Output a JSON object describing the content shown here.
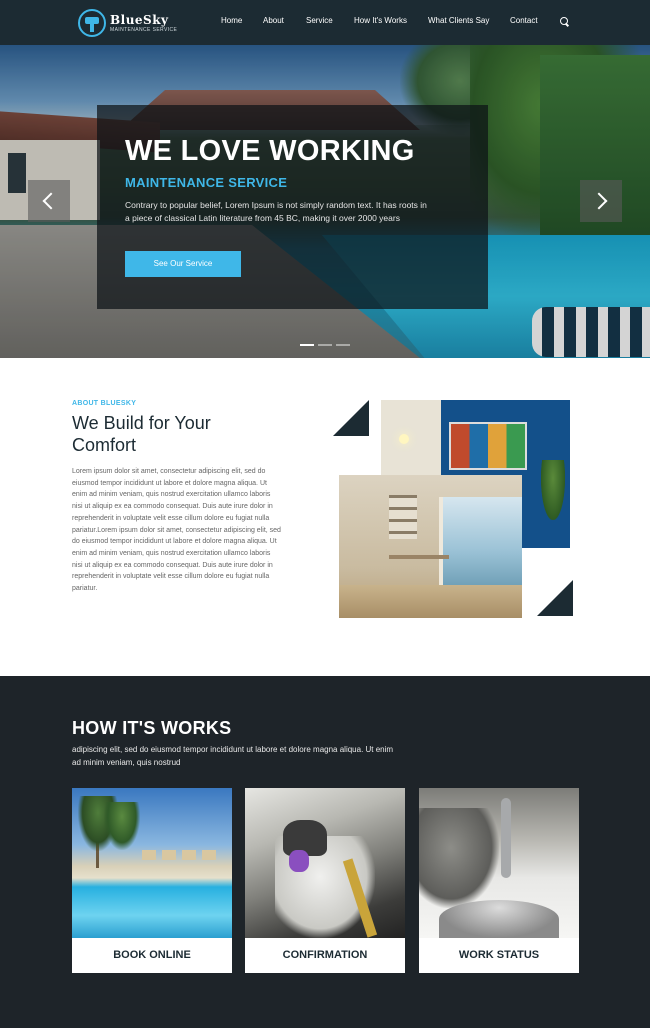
{
  "brand": {
    "name": "BlueSky",
    "tagline": "MAINTENANCE SERVICE"
  },
  "nav": {
    "items": [
      {
        "label": "Home"
      },
      {
        "label": "About"
      },
      {
        "label": "Service"
      },
      {
        "label": "How It's Works"
      },
      {
        "label": "What Clients Say"
      },
      {
        "label": "Contact"
      }
    ],
    "search_icon": "search-icon"
  },
  "hero": {
    "title": "WE LOVE WORKING",
    "subtitle": "MAINTENANCE SERVICE",
    "text": "Contrary to popular belief, Lorem Ipsum is not simply random text. It has roots in a piece of classical Latin literature from 45 BC, making it over 2000 years",
    "button_label": "See Our Service",
    "slides": 3,
    "active_slide": 1
  },
  "about": {
    "label": "ABOUT BLUESKY",
    "title": "We Build for Your Comfort",
    "text": "Lorem ipsum dolor sit amet, consectetur adipiscing elit, sed do eiusmod tempor incididunt ut labore et dolore magna aliqua. Ut enim ad minim veniam, quis nostrud exercitation ullamco laboris nisi ut aliquip ex ea commodo consequat. Duis aute irure dolor in reprehenderit in voluptate velit esse cillum dolore eu fugiat nulla pariatur.Lorem ipsum dolor sit amet, consectetur adipiscing elit, sed do eiusmod tempor incididunt ut labore et dolore magna aliqua. Ut enim ad minim veniam, quis nostrud exercitation ullamco laboris nisi ut aliquip ex ea commodo consequat. Duis aute irure dolor in reprehenderit in voluptate velit esse cillum dolore eu fugiat nulla pariatur."
  },
  "works": {
    "title": "HOW IT'S WORKS",
    "text": "adipiscing elit, sed do eiusmod tempor incididunt ut labore et dolore magna aliqua. Ut enim ad minim veniam, quis nostrud",
    "cards": [
      {
        "label": "BOOK ONLINE"
      },
      {
        "label": "CONFIRMATION"
      },
      {
        "label": "WORK STATUS"
      }
    ]
  },
  "colors": {
    "accent": "#3fb7e8",
    "dark": "#1c2b33",
    "section_bg": "#1e2429"
  }
}
